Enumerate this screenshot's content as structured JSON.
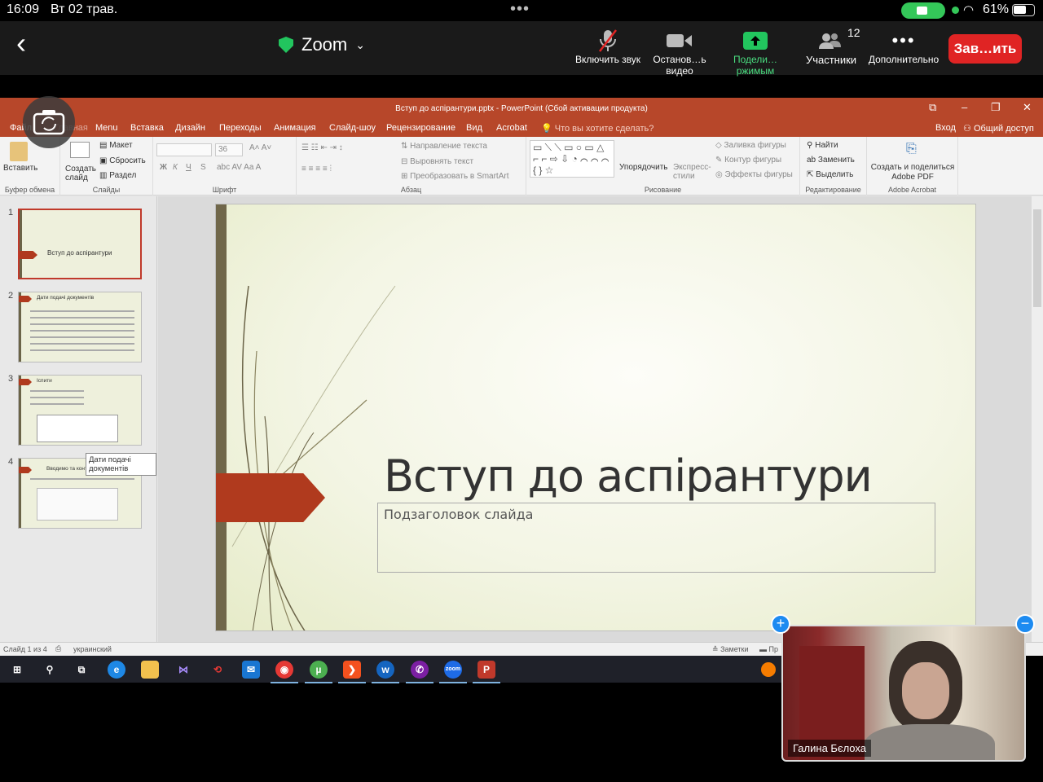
{
  "status_bar": {
    "time": "16:09",
    "date": "Вт 02 трав.",
    "battery": "61%"
  },
  "zoom": {
    "title": "Zoom",
    "buttons": [
      {
        "label": "Включить звук",
        "icon": "mic-muted-icon"
      },
      {
        "label": "Останов…ь видео",
        "icon": "video-camera-icon"
      },
      {
        "label": "Подели…ржимым",
        "icon": "share-screen-icon"
      },
      {
        "label": "Участники",
        "icon": "participants-icon",
        "count": "12"
      },
      {
        "label": "Дополнительно",
        "icon": "more-icon"
      }
    ],
    "end_label": "Зав…ить"
  },
  "powerpoint": {
    "window_title": "Вступ до аспірантури.pptx - PowerPoint (Сбой активации продукта)",
    "tabs": [
      "Файл",
      "Главная",
      "Menu",
      "Вставка",
      "Дизайн",
      "Переходы",
      "Анимация",
      "Слайд-шоу",
      "Рецензирование",
      "Вид",
      "Acrobat"
    ],
    "tell_me": "Что вы хотите сделать?",
    "signin": "Вход",
    "share": "Общий доступ",
    "ribbon": {
      "clipboard": {
        "label": "Буфер обмена",
        "paste": "Вставить"
      },
      "slides": {
        "label": "Слайды",
        "new_slide": "Создать слайд",
        "layout": "Макет",
        "reset": "Сбросить",
        "section": "Раздел"
      },
      "font": {
        "label": "Шрифт",
        "size": "36",
        "bold": "Ж",
        "italic": "К",
        "underline": "Ч",
        "shadow": "S"
      },
      "paragraph": {
        "label": "Абзац",
        "text_direction": "Направление текста",
        "align_text": "Выровнять текст",
        "smartart": "Преобразовать в SmartArt"
      },
      "drawing": {
        "label": "Рисование",
        "arrange": "Упорядочить",
        "quick_styles": "Экспресс-стили",
        "fill": "Заливка фигуры",
        "outline": "Контур фигуры",
        "effects": "Эффекты фигуры"
      },
      "editing": {
        "label": "Редактирование",
        "find": "Найти",
        "replace": "Заменить",
        "select": "Выделить"
      },
      "acrobat": {
        "label": "Adobe Acrobat",
        "create": "Создать и поделиться Adobe PDF"
      }
    },
    "thumbnails": [
      {
        "num": "1",
        "title": "Вступ до аспірантури"
      },
      {
        "num": "2",
        "title": "Дати подачі документів"
      },
      {
        "num": "3",
        "title": "Іспити"
      },
      {
        "num": "4",
        "title": "Вводимо та контроль"
      }
    ],
    "tooltip": "Дати подачі документів",
    "slide": {
      "title": "Вступ до аспірантури",
      "subtitle": "Подзаголовок слайда"
    },
    "statusbar": {
      "slide": "Слайд 1 из 4",
      "language": "украинский",
      "notes": "Заметки",
      "comments": "Пр"
    }
  },
  "video": {
    "name": "Галина Бєлоха"
  }
}
